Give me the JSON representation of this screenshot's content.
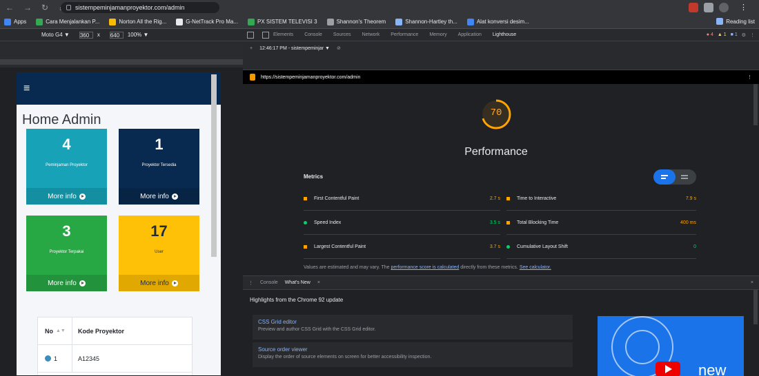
{
  "browser": {
    "url": "sistempeminjamanproyektor.com/admin",
    "nav_back": "←",
    "nav_fwd": "→",
    "nav_reload": "↻",
    "nav_home": "⌂"
  },
  "bookmarks": {
    "items": [
      "Apps",
      "Cara Menjalankan P...",
      "Norton All the Rig...",
      "G-NetTrack Pro Ma...",
      "PX SISTEM TELEVISI 3",
      "Shannon's Theorem",
      "Shannon-Hartley th...",
      "Alat konversi desim..."
    ],
    "reading_list": "Reading list"
  },
  "device_toolbar": {
    "device": "Moto G4 ▼",
    "width": "360",
    "x": "x",
    "height": "640",
    "zoom": "100% ▼"
  },
  "admin": {
    "hamburger": "≡",
    "title": "Home Admin",
    "boxes": [
      {
        "num": "4",
        "label": "Peminjaman Proyektor",
        "more": "More info",
        "color": "#17a2b8"
      },
      {
        "num": "1",
        "label": "Proyektor Tersedia",
        "more": "More info",
        "color": "#082a50"
      },
      {
        "num": "3",
        "label": "Proyektor Terpakai",
        "more": "More info",
        "color": "#28a745"
      },
      {
        "num": "17",
        "label": "User",
        "more": "More info",
        "color": "#ffc107"
      }
    ],
    "table": {
      "col_no": "No",
      "col_kode": "Kode Proyektor",
      "row_no": "1",
      "row_kode": "A12345"
    }
  },
  "devtools": {
    "tabs": [
      "Elements",
      "Console",
      "Sources",
      "Network",
      "Performance",
      "Memory",
      "Application",
      "Lighthouse"
    ],
    "active_tab": "Lighthouse",
    "errors": "● 4",
    "warnings": "▲ 1",
    "info": "■ 1",
    "sub_time": "12:46:17 PM - sistempeminjar ▼",
    "report_url": "https://sistempeminjamanproyektor.com/admin"
  },
  "lighthouse": {
    "score": "70",
    "score_value": 70,
    "category": "Performance",
    "metrics_label": "Metrics",
    "metrics": [
      {
        "name": "First Contentful Paint",
        "value": "2.7 s",
        "color": "#ffa400"
      },
      {
        "name": "Time to Interactive",
        "value": "7.9 s",
        "color": "#ffa400"
      },
      {
        "name": "Speed Index",
        "value": "3.5 s",
        "color": "#0cce6b"
      },
      {
        "name": "Total Blocking Time",
        "value": "400 ms",
        "color": "#ffa400"
      },
      {
        "name": "Largest Contentful Paint",
        "value": "3.7 s",
        "color": "#ffa400"
      },
      {
        "name": "Cumulative Layout Shift",
        "value": "0",
        "color": "#0cce6b"
      }
    ],
    "note": "Values are estimated and may vary. The ",
    "note_link": "performance score is calculated",
    "note_mid": " directly from these metrics. ",
    "note_link2": "See calculator."
  },
  "drawer": {
    "tab_console": "Console",
    "tab_whatsnew": "What's New",
    "close": "×",
    "highlight": "Highlights from the Chrome 92 update",
    "cards": [
      {
        "title": "CSS Grid editor",
        "desc": "Preview and author CSS Grid with the CSS Grid editor."
      },
      {
        "title": "Source order viewer",
        "desc": "Display the order of source elements on screen for better accessibility inspection."
      }
    ],
    "video_text": "new"
  }
}
